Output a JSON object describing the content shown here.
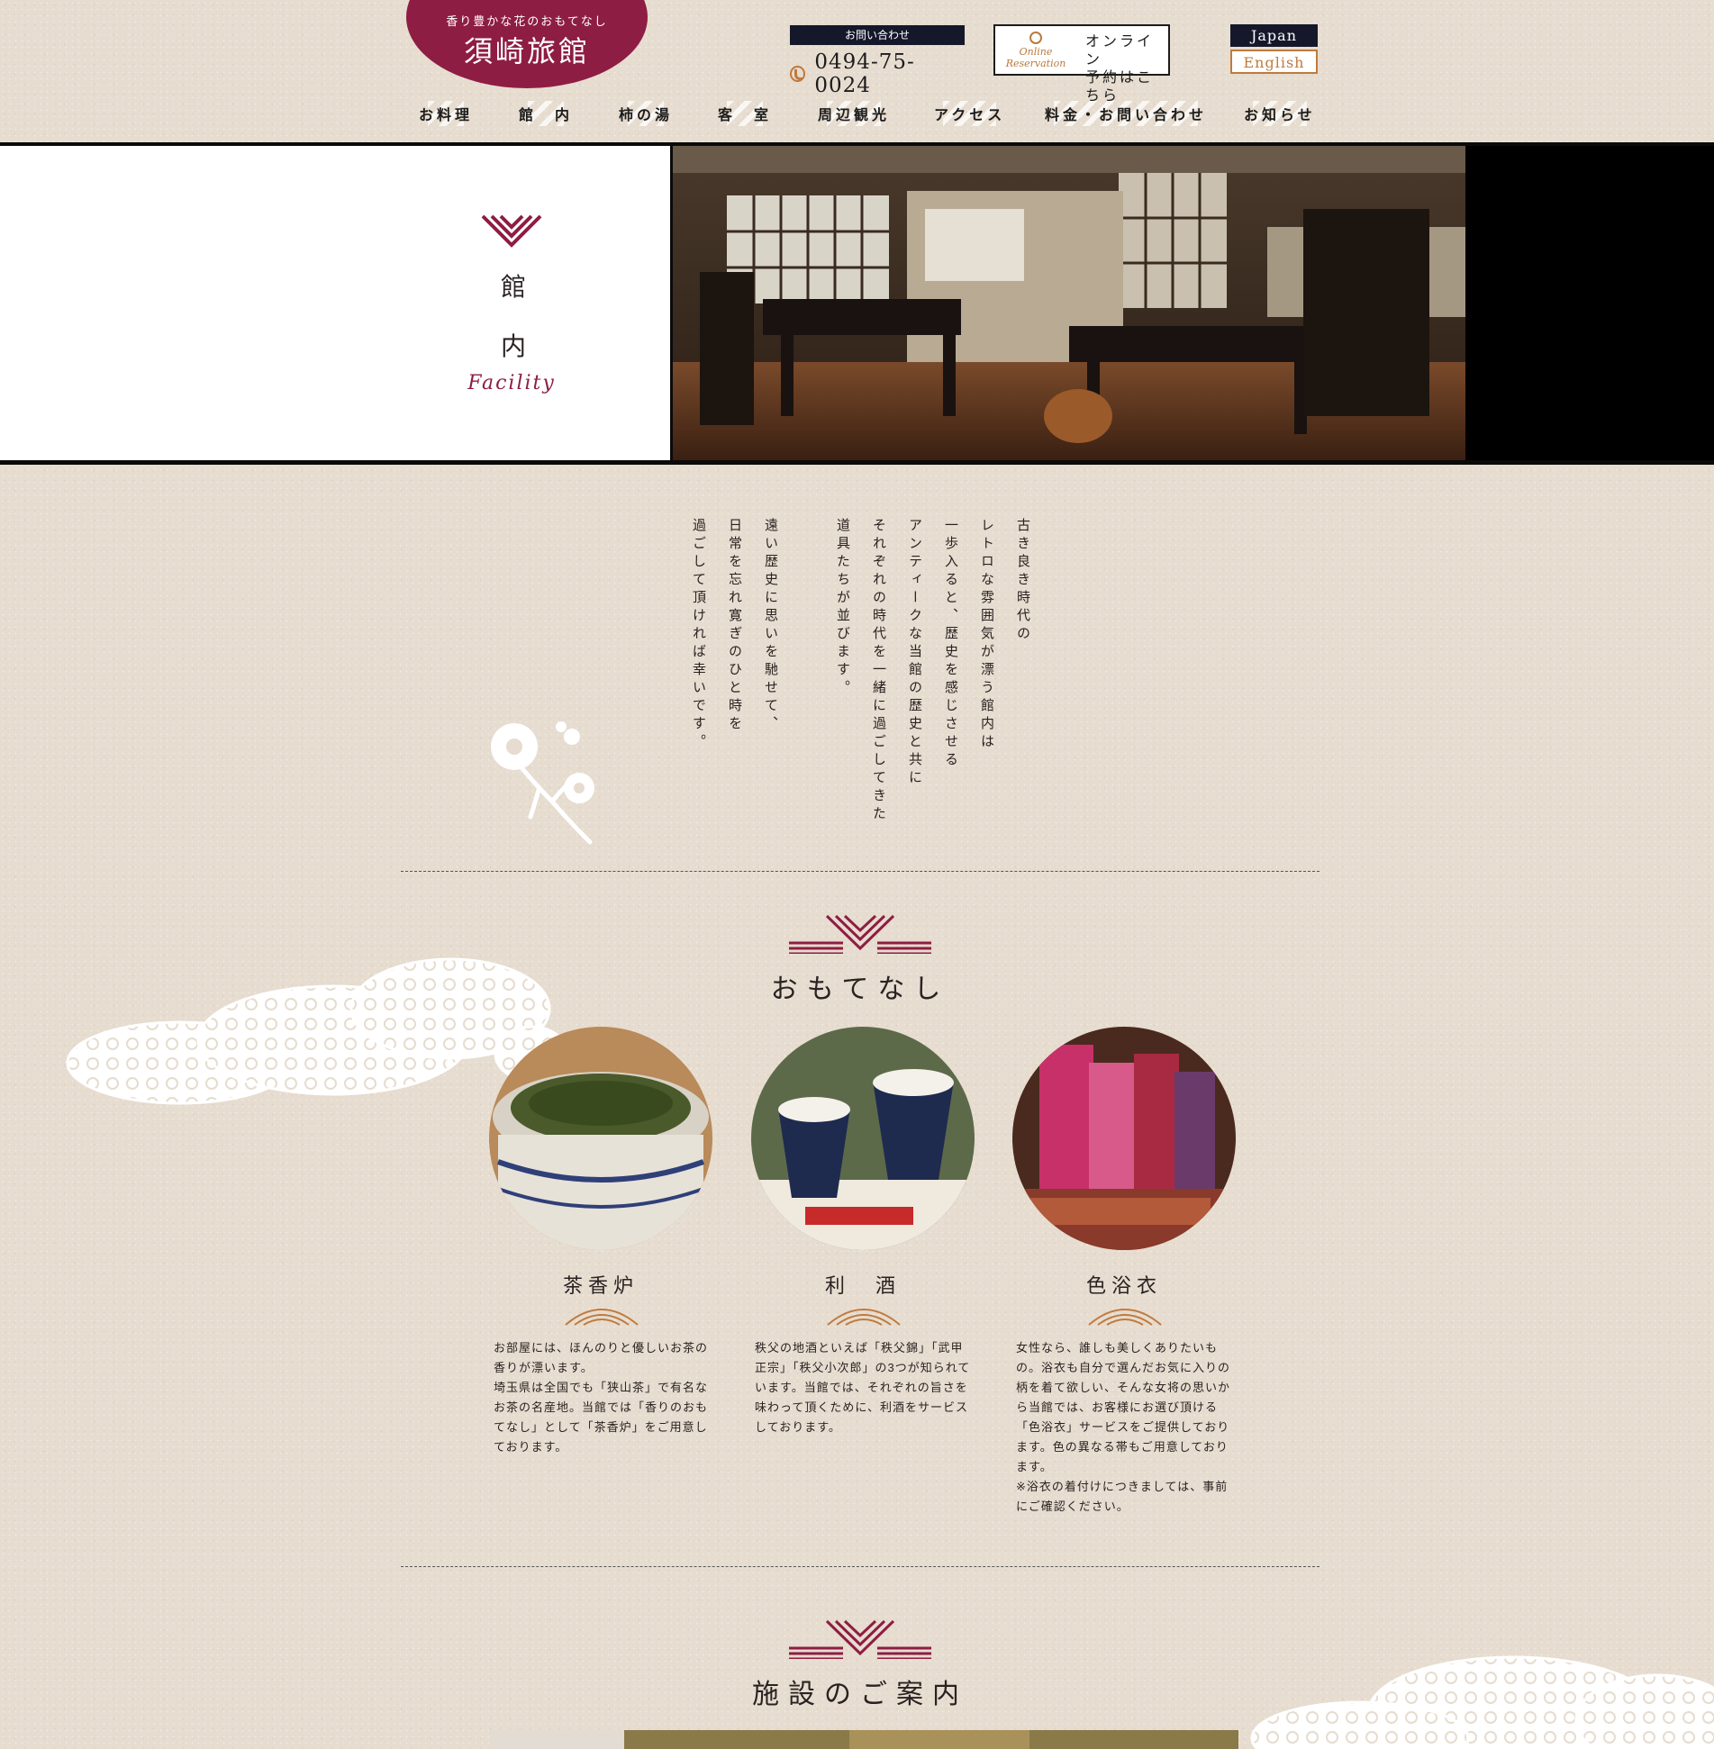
{
  "header": {
    "logo_tagline": "香り豊かな花のおもてなし",
    "logo_name": "須崎旅館",
    "contact_label": "お問い合わせ",
    "phone": "0494-75-0024",
    "reserve_mark_line1": "Online",
    "reserve_mark_line2": "Reservation",
    "reserve_line1": "オンライン",
    "reserve_line2": "予約はこちら",
    "lang_japan": "Japan",
    "lang_english": "English"
  },
  "nav": [
    "お料理",
    "館　内",
    "柿の湯",
    "客　室",
    "周辺観光",
    "アクセス",
    "料金・お問い合わせ",
    "お知らせ"
  ],
  "hero": {
    "title_char1": "館",
    "title_char2": "内",
    "subtitle": "Facility"
  },
  "intro_lines": [
    "古き良き時代の",
    "レトロな雰囲気が漂う館内は",
    "一歩入ると、歴史を感じさせる",
    "アンティークな当館の歴史と共に",
    "それぞれの時代を一緒に過ごしてきた",
    "道具たちが並びます。",
    "遠い歴史に思いを馳せて、",
    "日常を忘れ寛ぎのひと時を",
    "過ごして頂ければ幸いです。"
  ],
  "omotenashi": {
    "title": "おもてなし",
    "features": [
      {
        "name": "茶香炉",
        "desc": "お部屋には、ほんのりと優しいお茶の香りが漂います。\n埼玉県は全国でも「狭山茶」で有名なお茶の名産地。当館では「香りのおもてなし」として「茶香炉」をご用意しております。"
      },
      {
        "name": "利　酒",
        "desc": "秩父の地酒といえば「秩父錦」「武甲正宗」「秩父小次郎」の3つが知られています。当館では、それぞれの旨さを味わって頂くために、利酒をサービスしております。"
      },
      {
        "name": "色浴衣",
        "desc": "女性なら、誰しも美しくありたいもの。浴衣も自分で選んだお気に入りの柄を着て欲しい、そんな女将の思いから当館では、お客様にお選び頂ける「色浴衣」サービスをご提供しております。色の異なる帯もご用意しております。\n※浴衣の着付けにつきましては、事前にご確認ください。"
      }
    ]
  },
  "facilities": {
    "title": "施設のご案内"
  },
  "colors": {
    "brand": "#8e1d43",
    "navy": "#14182a",
    "accent": "#c07a3e",
    "paper": "#e6dccf"
  }
}
